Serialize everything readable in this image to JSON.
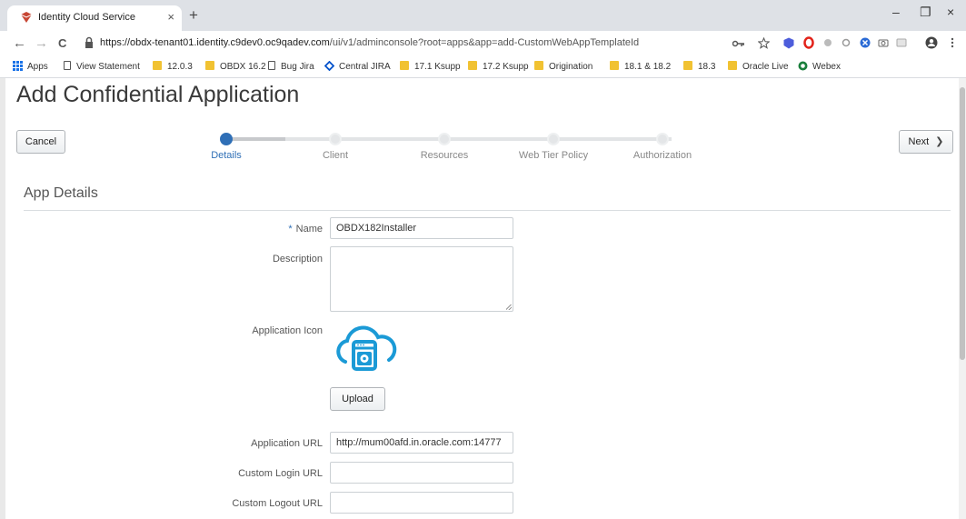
{
  "browser": {
    "tab_title": "Identity Cloud Service",
    "tab_close": "×",
    "new_tab": "+",
    "window_minimize": "–",
    "window_restore": "❐",
    "window_close": "×",
    "url_host": "https://obdx-tenant01.identity.c9dev0.oc9qadev.com",
    "url_path": "/ui/v1/adminconsole?root=apps&app=add-CustomWebAppTemplateId",
    "back": "←",
    "forward": "→",
    "reload": "C",
    "bookmarks": [
      {
        "label": "Apps",
        "icon": "apps-grid-icon"
      },
      {
        "label": "View Statement",
        "icon": "page-icon"
      },
      {
        "label": "12.0.3",
        "icon": "folder-icon"
      },
      {
        "label": "OBDX 16.2",
        "icon": "folder-icon"
      },
      {
        "label": "Bug Jira",
        "icon": "page-icon"
      },
      {
        "label": "Central JIRA",
        "icon": "jira-icon"
      },
      {
        "label": "17.1 Ksupp",
        "icon": "folder-icon"
      },
      {
        "label": "17.2 Ksupp",
        "icon": "folder-icon"
      },
      {
        "label": "Origination",
        "icon": "folder-icon"
      },
      {
        "label": "18.1 & 18.2",
        "icon": "folder-icon"
      },
      {
        "label": "18.3",
        "icon": "folder-icon"
      },
      {
        "label": "Oracle Live",
        "icon": "folder-icon"
      },
      {
        "label": "Webex",
        "icon": "webex-icon"
      }
    ]
  },
  "page": {
    "title": "Add Confidential Application",
    "cancel_label": "Cancel",
    "next_label": "Next",
    "next_chevron": "❯",
    "steps": [
      {
        "label": "Details",
        "active": true
      },
      {
        "label": "Client",
        "active": false
      },
      {
        "label": "Resources",
        "active": false
      },
      {
        "label": "Web Tier Policy",
        "active": false
      },
      {
        "label": "Authorization",
        "active": false
      }
    ],
    "section_title": "App Details",
    "form": {
      "required_marker": "*",
      "name_label": "Name",
      "name_value": "OBDX182Installer",
      "description_label": "Description",
      "description_value": "",
      "icon_label": "Application Icon",
      "upload_label": "Upload",
      "app_url_label": "Application URL",
      "app_url_value": "http://mum00afd.in.oracle.com:14777",
      "login_url_label": "Custom Login URL",
      "login_url_value": "",
      "logout_url_label": "Custom Logout URL",
      "logout_url_value": ""
    }
  },
  "colors": {
    "accent": "#2f6fb6",
    "icon_blue": "#1b9ad6"
  }
}
